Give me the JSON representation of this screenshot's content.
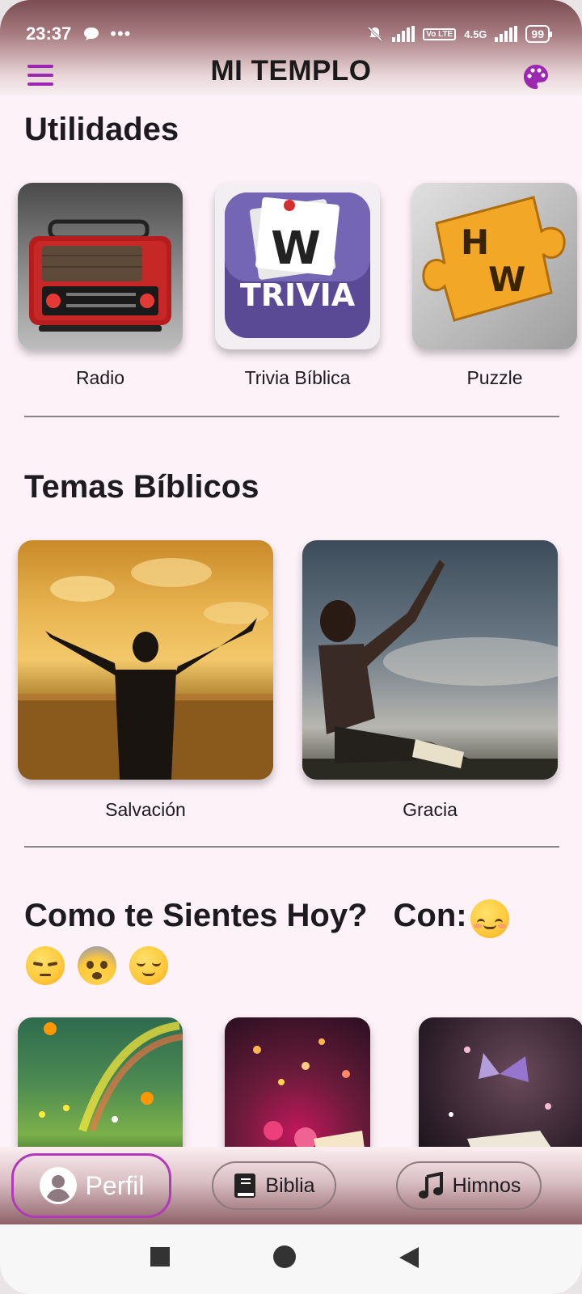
{
  "status_bar": {
    "time": "23:37",
    "network": "4.5G",
    "volte": "Vo LTE",
    "battery": "99"
  },
  "app_bar": {
    "title": "MI TEMPLO",
    "menu_icon": "menu-icon",
    "theme_icon": "palette-icon"
  },
  "utilities": {
    "title": "Utilidades",
    "items": [
      {
        "label": "Radio",
        "icon": "radio-image"
      },
      {
        "label": "Trivia Bíblica",
        "icon": "trivia-image",
        "tile_text": "TRIVIA",
        "tile_letter": "W"
      },
      {
        "label": "Puzzle",
        "icon": "puzzle-image",
        "tile_letters": [
          "H",
          "W"
        ]
      }
    ]
  },
  "themes": {
    "title": "Temas Bíblicos",
    "items": [
      {
        "label": "Salvación",
        "icon": "salvation-image"
      },
      {
        "label": "Gracia",
        "icon": "grace-image"
      }
    ]
  },
  "feelings": {
    "title": "Como te Sientes Hoy?",
    "with_label": "Con:",
    "emojis": [
      "smiling-face",
      "pensive-face",
      "anxious-face",
      "relieved-face"
    ]
  },
  "bottom_nav": {
    "items": [
      {
        "label": "Perfil",
        "icon": "profile-icon",
        "active": true
      },
      {
        "label": "Biblia",
        "icon": "bible-icon",
        "active": false
      },
      {
        "label": "Himnos",
        "icon": "music-note-icon",
        "active": false
      }
    ]
  },
  "colors": {
    "accent": "#9c27b0",
    "background": "#fdf2f8",
    "active_border": "#b03ab9"
  }
}
